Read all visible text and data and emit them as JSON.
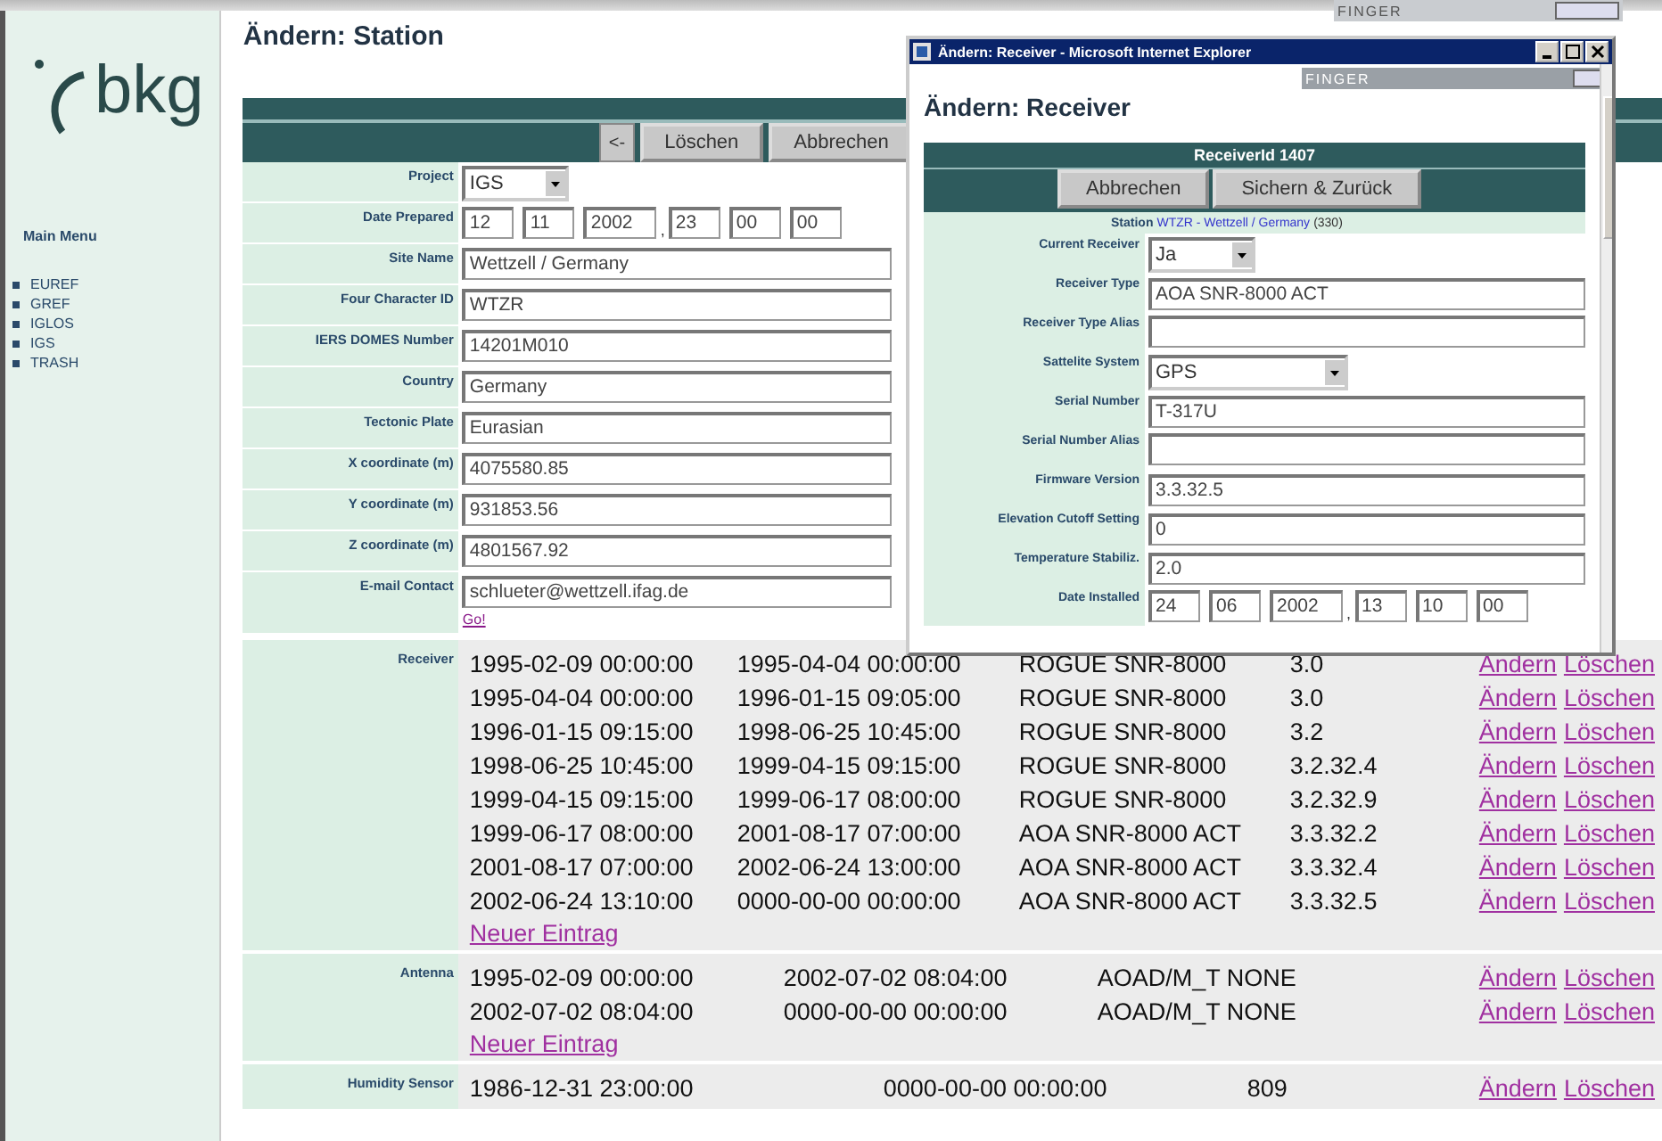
{
  "sidebar": {
    "logo": "bkg",
    "menu_title": "Main Menu",
    "items": [
      "EUREF",
      "GREF",
      "IGLOS",
      "IGS",
      "TRASH"
    ]
  },
  "station": {
    "heading": "Ändern: Station",
    "buttons": [
      "<-",
      "Löschen",
      "Abbrechen"
    ],
    "fields": [
      {
        "label": "Project",
        "kind": "select",
        "value": "IGS"
      },
      {
        "label": "Date Prepared",
        "kind": "datetime",
        "date": [
          "12",
          "11",
          "2002"
        ],
        "separator": ",",
        "time": [
          "23",
          "00",
          "00"
        ]
      },
      {
        "label": "Site Name",
        "kind": "text",
        "value": "Wettzell / Germany"
      },
      {
        "label": "Four Character ID",
        "kind": "text",
        "value": "WTZR"
      },
      {
        "label": "IERS DOMES Number",
        "kind": "text",
        "value": "14201M010"
      },
      {
        "label": "Country",
        "kind": "text",
        "value": "Germany"
      },
      {
        "label": "Tectonic Plate",
        "kind": "text",
        "value": "Eurasian"
      },
      {
        "label": "X coordinate (m)",
        "kind": "text",
        "value": "4075580.85"
      },
      {
        "label": "Y coordinate (m)",
        "kind": "text",
        "value": "931853.56"
      },
      {
        "label": "Z coordinate (m)",
        "kind": "text",
        "value": "4801567.92"
      },
      {
        "label": "E-mail Contact",
        "kind": "text",
        "value": "schlueter@wettzell.ifag.de",
        "link": "Go!"
      }
    ],
    "history": [
      {
        "label": "Receiver",
        "kind": "receiver",
        "new_link": "Neuer Eintrag",
        "rows": [
          {
            "cells": [
              "1995-02-09 00:00:00",
              "1995-04-04 00:00:00",
              "ROGUE SNR-8000",
              "3.0"
            ],
            "actions": [
              "Ändern",
              "Löschen"
            ]
          },
          {
            "cells": [
              "1995-04-04 00:00:00",
              "1996-01-15 09:05:00",
              "ROGUE SNR-8000",
              "3.0"
            ],
            "actions": [
              "Ändern",
              "Löschen"
            ]
          },
          {
            "cells": [
              "1996-01-15 09:15:00",
              "1998-06-25 10:45:00",
              "ROGUE SNR-8000",
              "3.2"
            ],
            "actions": [
              "Ändern",
              "Löschen"
            ]
          },
          {
            "cells": [
              "1998-06-25 10:45:00",
              "1999-04-15 09:15:00",
              "ROGUE SNR-8000",
              "3.2.32.4"
            ],
            "actions": [
              "Ändern",
              "Löschen"
            ]
          },
          {
            "cells": [
              "1999-04-15 09:15:00",
              "1999-06-17 08:00:00",
              "ROGUE SNR-8000",
              "3.2.32.9"
            ],
            "actions": [
              "Ändern",
              "Löschen"
            ]
          },
          {
            "cells": [
              "1999-06-17 08:00:00",
              "2001-08-17 07:00:00",
              "AOA SNR-8000 ACT",
              "3.3.32.2"
            ],
            "actions": [
              "Ändern",
              "Löschen"
            ]
          },
          {
            "cells": [
              "2001-08-17 07:00:00",
              "2002-06-24 13:00:00",
              "AOA SNR-8000 ACT",
              "3.3.32.4"
            ],
            "actions": [
              "Ändern",
              "Löschen"
            ]
          },
          {
            "cells": [
              "2002-06-24 13:10:00",
              "0000-00-00 00:00:00",
              "AOA SNR-8000 ACT",
              "3.3.32.5"
            ],
            "actions": [
              "Ändern",
              "Löschen"
            ]
          }
        ]
      },
      {
        "label": "Antenna",
        "kind": "antenna",
        "new_link": "Neuer Eintrag",
        "rows": [
          {
            "cells": [
              "1995-02-09 00:00:00",
              "2002-07-02 08:04:00",
              "AOAD/M_T NONE"
            ],
            "actions": [
              "Ändern",
              "Löschen"
            ]
          },
          {
            "cells": [
              "2002-07-02 08:04:00",
              "0000-00-00 00:00:00",
              "AOAD/M_T NONE"
            ],
            "actions": [
              "Ändern",
              "Löschen"
            ]
          }
        ]
      },
      {
        "label": "Humidity Sensor",
        "kind": "humidity",
        "rows": [
          {
            "cells": [
              "1986-12-31 23:00:00",
              "0000-00-00 00:00:00",
              "809"
            ],
            "actions": [
              "Ändern",
              "Löschen"
            ]
          }
        ]
      }
    ]
  },
  "finger_bar": {
    "label": "FINGER"
  },
  "popup": {
    "title": "Ändern: Receiver - Microsoft Internet Explorer",
    "finger_label": "FINGER",
    "heading": "Ändern: Receiver",
    "table_title": "ReceiverId 1407",
    "buttons": [
      "Abbrechen",
      "Sichern & Zurück"
    ],
    "station": {
      "label": "Station",
      "link": "WTZR - Wettzell / Germany",
      "suffix": "(330)"
    },
    "fields": [
      {
        "label": "Current Receiver",
        "kind": "select",
        "value": "Ja"
      },
      {
        "label": "Receiver Type",
        "kind": "text",
        "value": "AOA SNR-8000 ACT"
      },
      {
        "label": "Receiver Type Alias",
        "kind": "text"
      },
      {
        "label": "Sattelite System",
        "kind": "wideselect",
        "value": "GPS"
      },
      {
        "label": "Serial Number",
        "kind": "text",
        "value": "T-317U"
      },
      {
        "label": "Serial Number Alias",
        "kind": "text"
      },
      {
        "label": "Firmware Version",
        "kind": "text",
        "value": "3.3.32.5"
      },
      {
        "label": "Elevation Cutoff Setting",
        "kind": "text",
        "value": "0"
      },
      {
        "label": "Temperature Stabiliz.",
        "kind": "text",
        "value": "2.0"
      },
      {
        "label": "Date Installed",
        "kind": "datetime",
        "date": [
          "24",
          "06",
          "2002"
        ],
        "separator": ",",
        "time": [
          "13",
          "10",
          "00"
        ]
      }
    ]
  }
}
